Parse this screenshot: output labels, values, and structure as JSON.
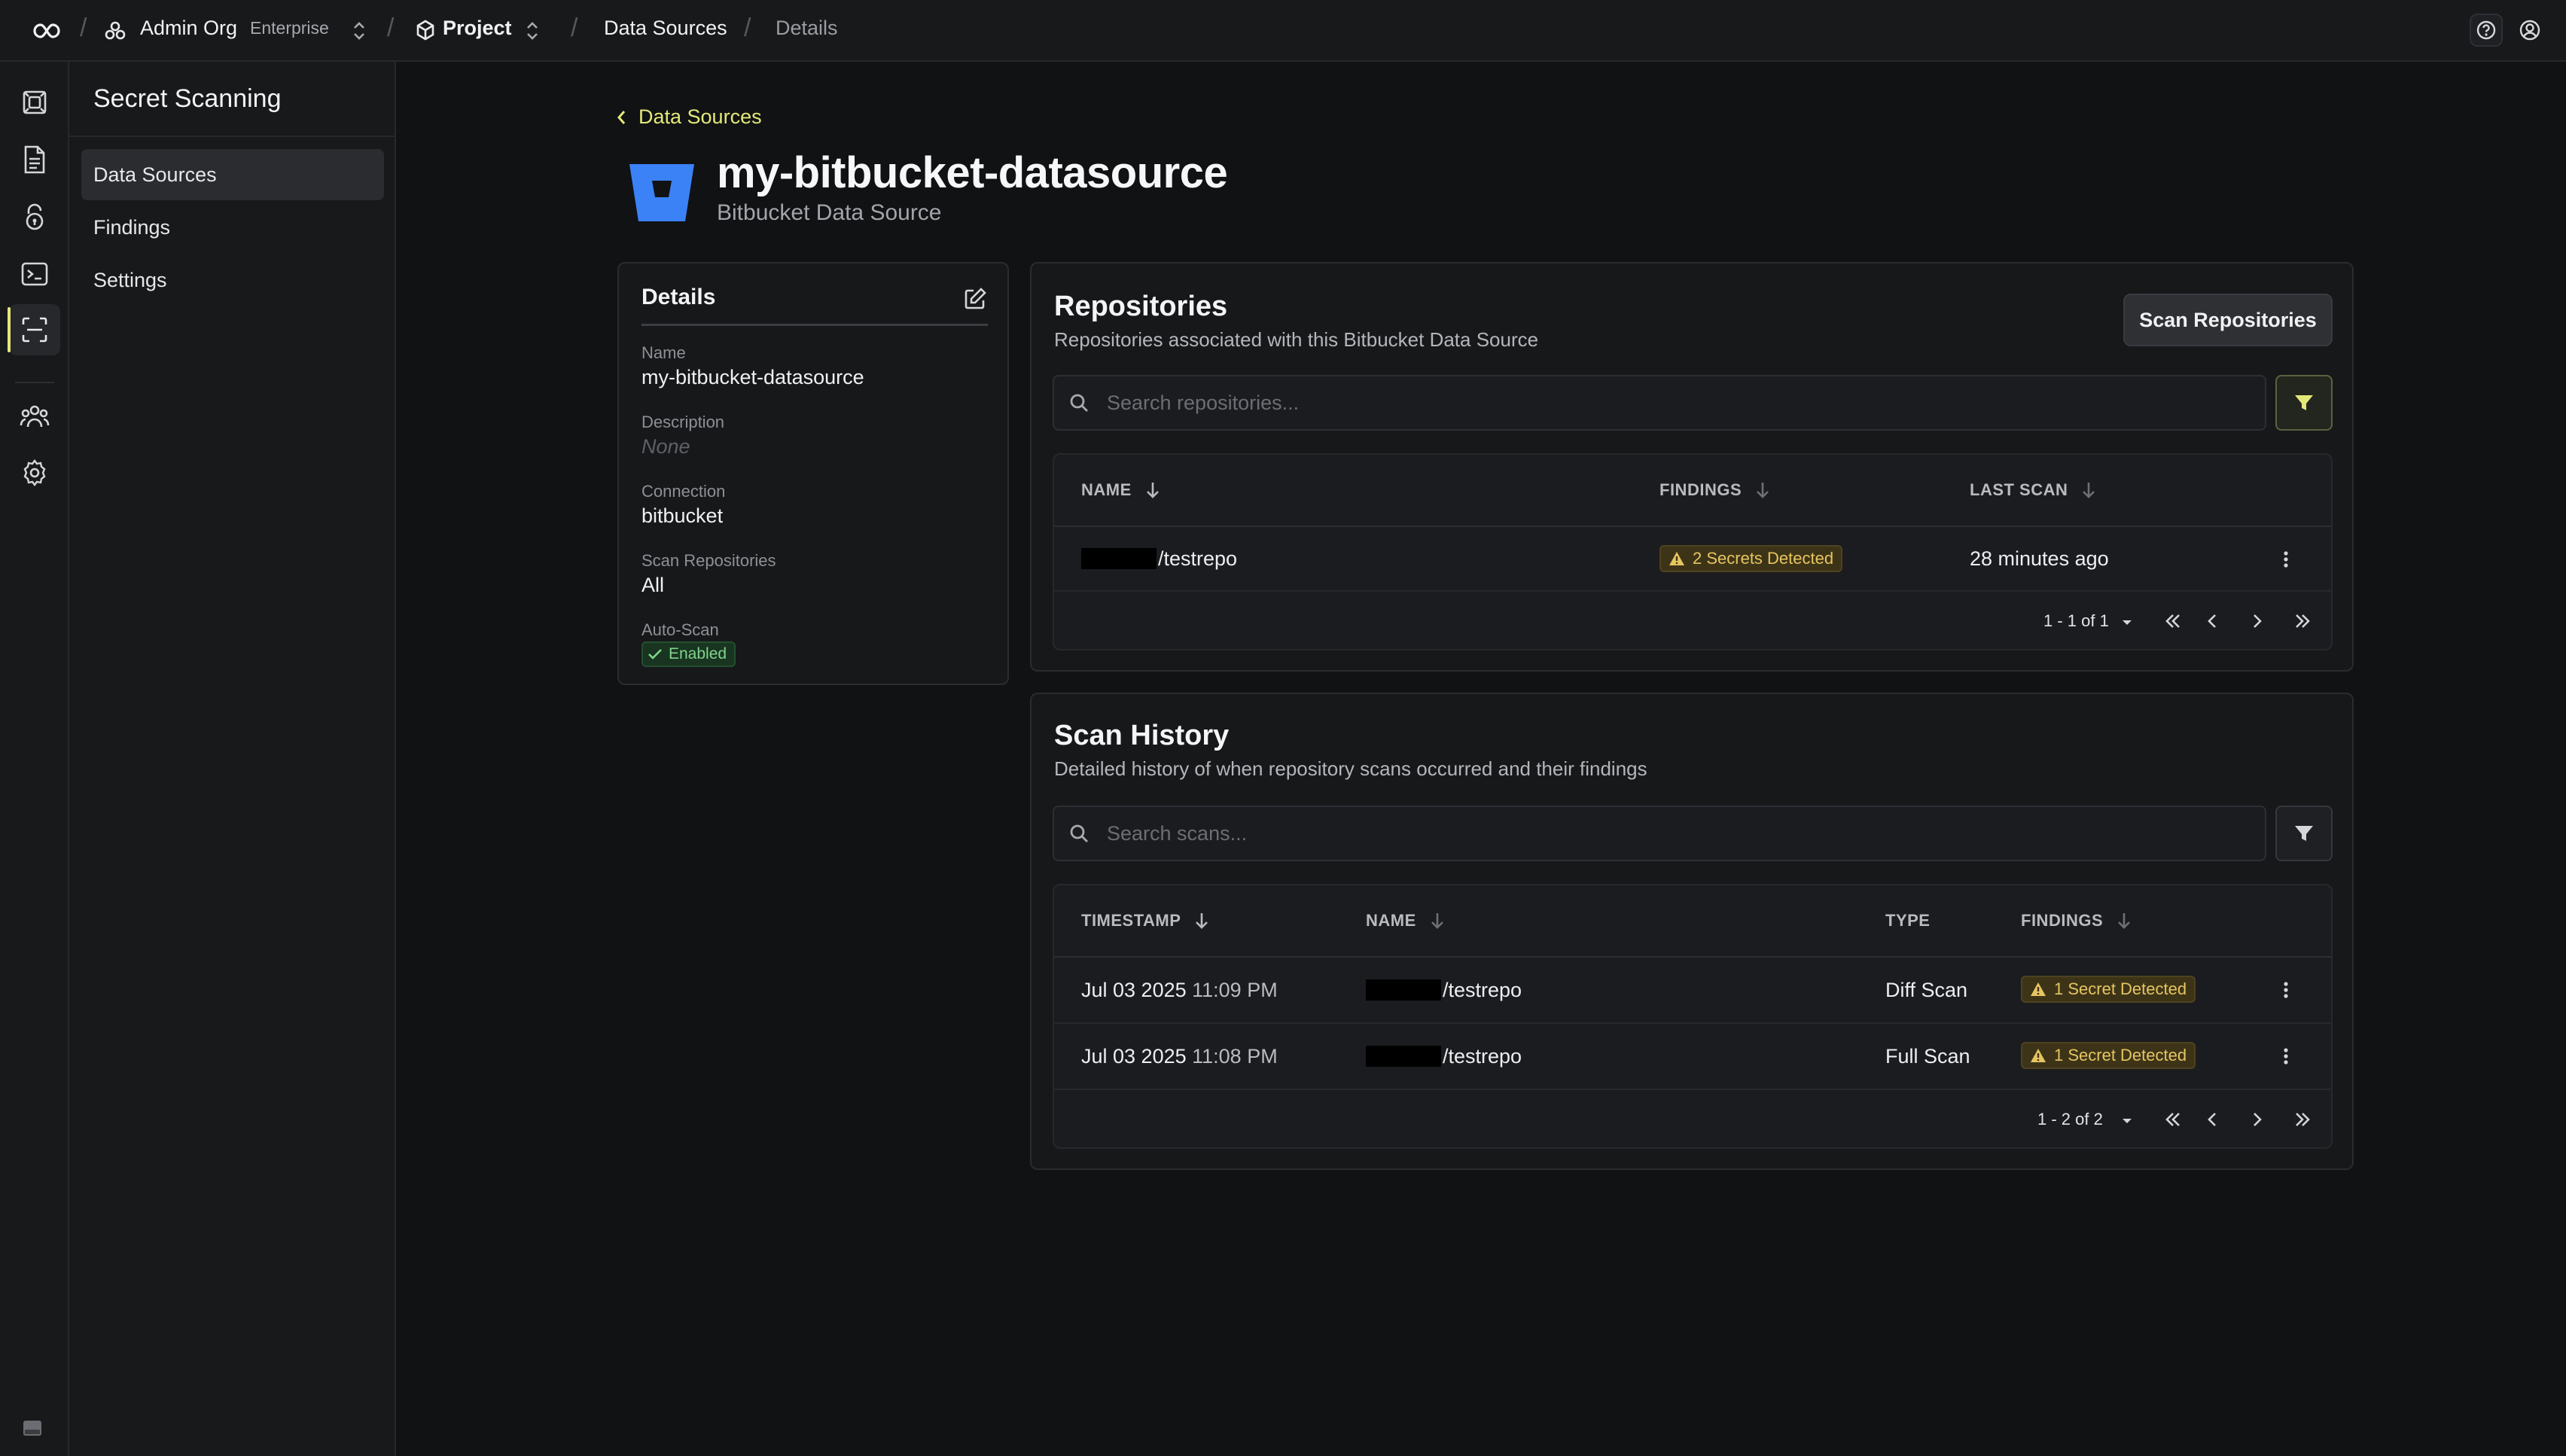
{
  "topbar": {
    "org_name": "Admin Org",
    "org_tier": "Enterprise",
    "project_name": "Project",
    "crumb_data_sources": "Data Sources",
    "crumb_details": "Details"
  },
  "sidebar": {
    "title": "Secret Scanning",
    "items": [
      {
        "label": "Data Sources",
        "active": true
      },
      {
        "label": "Findings",
        "active": false
      },
      {
        "label": "Settings",
        "active": false
      }
    ]
  },
  "page": {
    "back_label": "Data Sources",
    "title": "my-bitbucket-datasource",
    "subtitle": "Bitbucket Data Source"
  },
  "details": {
    "heading": "Details",
    "name_label": "Name",
    "name_value": "my-bitbucket-datasource",
    "description_label": "Description",
    "description_value": "None",
    "connection_label": "Connection",
    "connection_value": "bitbucket",
    "scan_repos_label": "Scan Repositories",
    "scan_repos_value": "All",
    "autoscan_label": "Auto-Scan",
    "autoscan_value": "Enabled"
  },
  "repositories": {
    "title": "Repositories",
    "subtitle": "Repositories associated with this Bitbucket Data Source",
    "scan_button": "Scan Repositories",
    "search_placeholder": "Search repositories...",
    "columns": [
      "NAME",
      "FINDINGS",
      "LAST SCAN"
    ],
    "rows": [
      {
        "name": "/testrepo",
        "findings": "2 Secrets Detected",
        "last_scan": "28 minutes ago"
      }
    ],
    "pagination": "1 - 1 of 1"
  },
  "scan_history": {
    "title": "Scan History",
    "subtitle": "Detailed history of when repository scans occurred and their findings",
    "search_placeholder": "Search scans...",
    "columns": [
      "TIMESTAMP",
      "NAME",
      "TYPE",
      "FINDINGS"
    ],
    "rows": [
      {
        "date": "Jul 03 2025",
        "time": "11:09 PM",
        "name": "/testrepo",
        "type": "Diff Scan",
        "findings": "1 Secret Detected"
      },
      {
        "date": "Jul 03 2025",
        "time": "11:08 PM",
        "name": "/testrepo",
        "type": "Full Scan",
        "findings": "1 Secret Detected"
      }
    ],
    "pagination": "1 - 2 of 2"
  },
  "colors": {
    "accent": "#e3e879",
    "background": "#111214",
    "panel": "#17181a",
    "bitbucket_blue": "#3b82f6",
    "warning": "#e6c560",
    "success": "#7fd58b"
  },
  "icons": [
    "infinity-logo",
    "org-icon",
    "project-cube-icon",
    "chevron-updown-icon",
    "help-icon",
    "user-icon",
    "rail-secret-manager-icon",
    "rail-documents-icon",
    "rail-lock-icon",
    "rail-terminal-icon",
    "rail-scan-icon",
    "rail-users-icon",
    "rail-settings-icon",
    "chevron-left-icon",
    "bitbucket-icon",
    "edit-icon",
    "check-icon",
    "search-icon",
    "filter-icon",
    "sort-arrow-icon",
    "warning-icon",
    "kebab-icon",
    "first-page-icon",
    "prev-page-icon",
    "next-page-icon",
    "last-page-icon"
  ]
}
